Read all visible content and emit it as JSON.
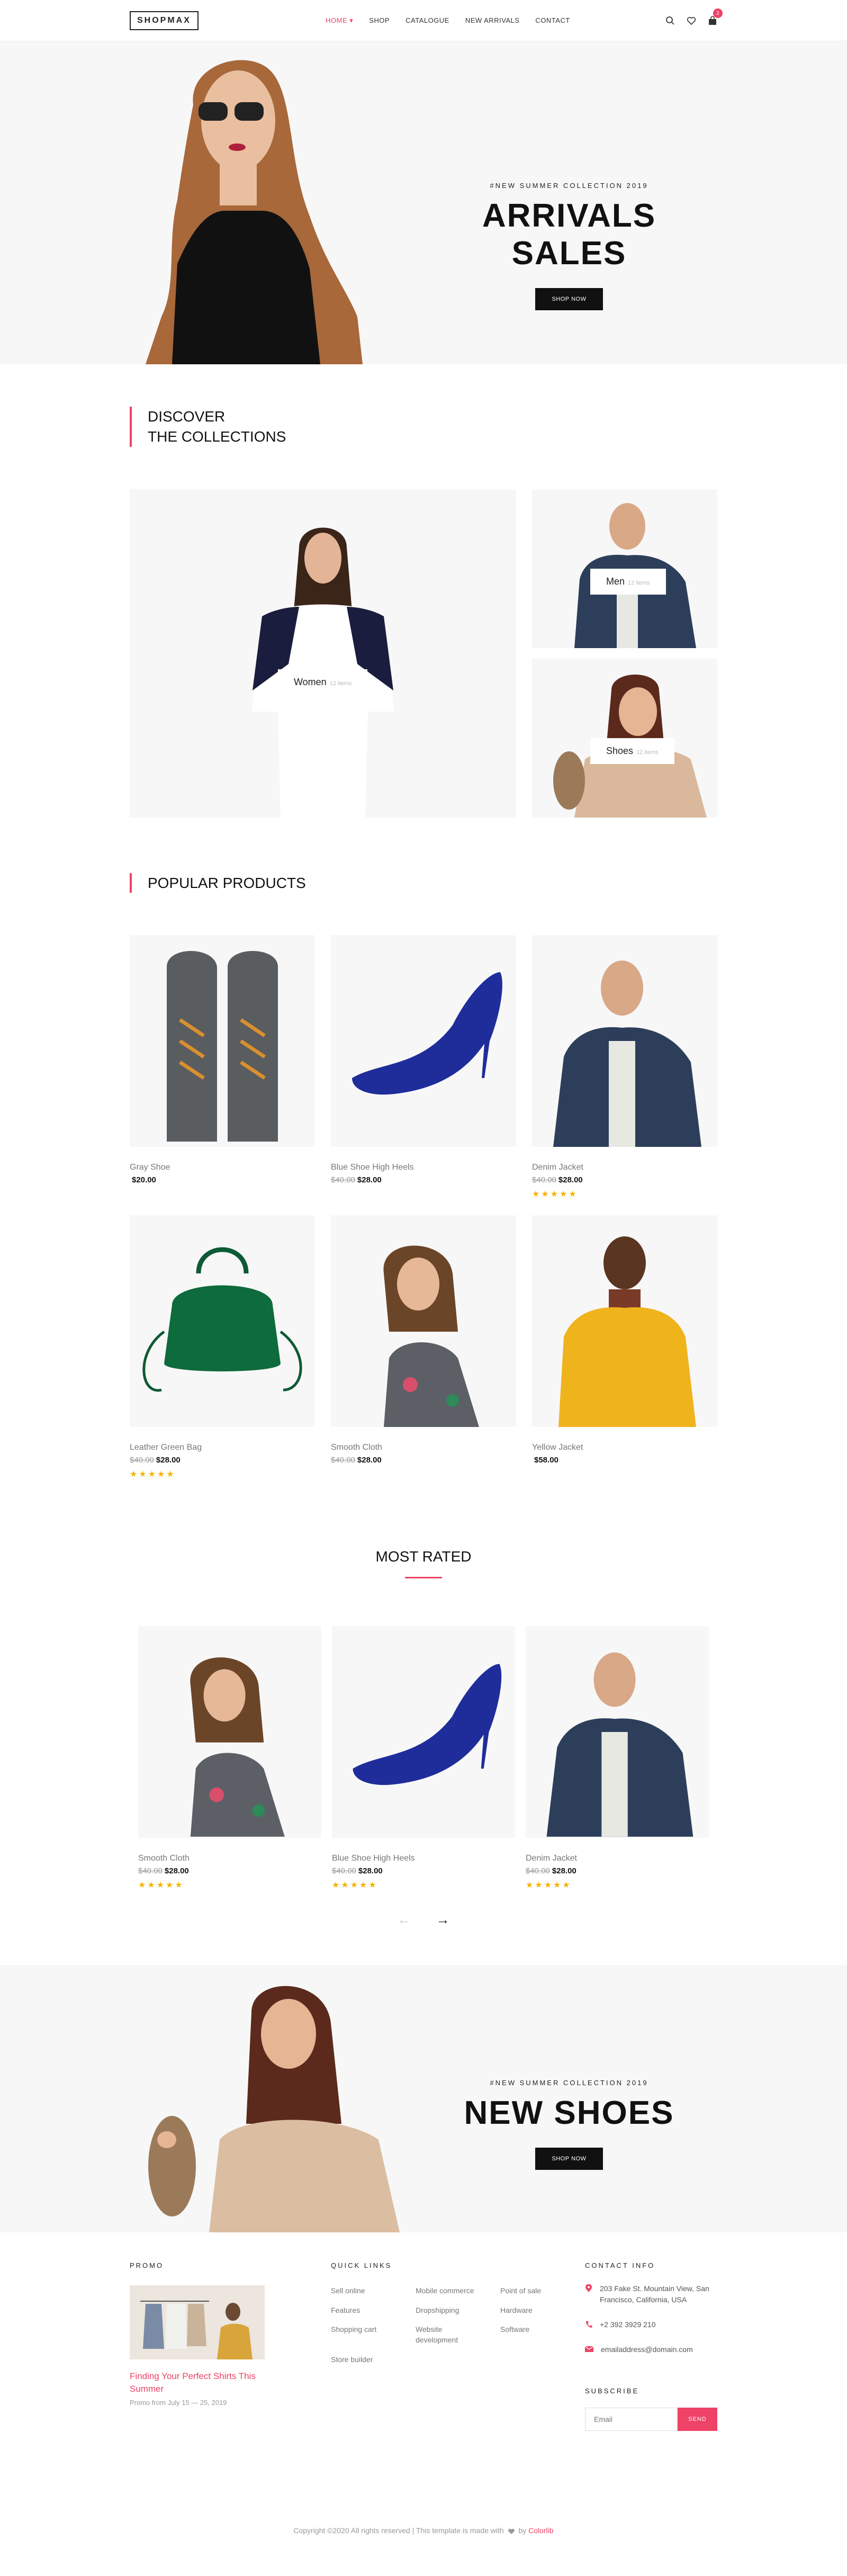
{
  "brand": {
    "logo": "SHOPMAX",
    "accent": "#ee4266"
  },
  "nav": {
    "items": [
      {
        "label": "HOME ▾",
        "active": true
      },
      {
        "label": "SHOP"
      },
      {
        "label": "CATALOGUE"
      },
      {
        "label": "NEW ARRIVALS"
      },
      {
        "label": "CONTACT"
      }
    ],
    "cart_count": "2",
    "icons": [
      "search-icon",
      "heart-icon",
      "bag-icon"
    ]
  },
  "hero": {
    "eyebrow": "#NEW SUMMER COLLECTION 2019",
    "title": "ARRIVALS SALES",
    "button": "SHOP NOW"
  },
  "collections": {
    "title_line1": "DISCOVER",
    "title_line2": "THE COLLECTIONS",
    "cards": [
      {
        "label": "Women",
        "count": "12 items"
      },
      {
        "label": "Men",
        "count": "12 items"
      },
      {
        "label": "Shoes",
        "count": "12 items"
      }
    ]
  },
  "popular": {
    "title": "POPULAR PRODUCTS",
    "products": [
      {
        "name": "Gray Shoe",
        "old_price": "",
        "price": "$20.00",
        "stars": ""
      },
      {
        "name": "Blue Shoe High Heels",
        "old_price": "$40.00",
        "price": "$28.00",
        "stars": ""
      },
      {
        "name": "Denim Jacket",
        "old_price": "$40.00",
        "price": "$28.00",
        "stars": "★★★★★"
      },
      {
        "name": "Leather Green Bag",
        "old_price": "$40.00",
        "price": "$28.00",
        "stars": "★★★★★"
      },
      {
        "name": "Smooth Cloth",
        "old_price": "$40.00",
        "price": "$28.00",
        "stars": ""
      },
      {
        "name": "Yellow Jacket",
        "old_price": "",
        "price": "$58.00",
        "stars": ""
      }
    ]
  },
  "most_rated": {
    "title": "MOST RATED",
    "products": [
      {
        "name": "Smooth Cloth",
        "old_price": "$40.00",
        "price": "$28.00",
        "stars": "★★★★★"
      },
      {
        "name": "Blue Shoe High Heels",
        "old_price": "$40.00",
        "price": "$28.00",
        "stars": "★★★★★"
      },
      {
        "name": "Denim Jacket",
        "old_price": "$40.00",
        "price": "$28.00",
        "stars": "★★★★★"
      }
    ],
    "prev": "←",
    "next": "→"
  },
  "banner2": {
    "eyebrow": "#NEW SUMMER COLLECTION 2019",
    "title": "NEW SHOES",
    "button": "SHOP NOW"
  },
  "footer": {
    "promo_head": "PROMO",
    "promo_link": "Finding Your Perfect Shirts This Summer",
    "promo_date": "Promo from July 15 — 25, 2019",
    "quick_head": "QUICK LINKS",
    "quick_links": [
      "Sell online",
      "Mobile commerce",
      "Point of sale",
      "Features",
      "Dropshipping",
      "Hardware",
      "Shopping cart",
      "Website development",
      "Software",
      "Store builder"
    ],
    "contact_head": "CONTACT INFO",
    "address": "203 Fake St. Mountain View, San Francisco, California, USA",
    "phone": "+2 392 3929 210",
    "email": "emailaddress@domain.com",
    "subscribe_head": "SUBSCRIBE",
    "email_placeholder": "Email",
    "send": "SEND",
    "copyright_text": "Copyright ©2020 All rights reserved | This template is made with",
    "copyright_by": "by",
    "copyright_link": "Colorlib"
  }
}
